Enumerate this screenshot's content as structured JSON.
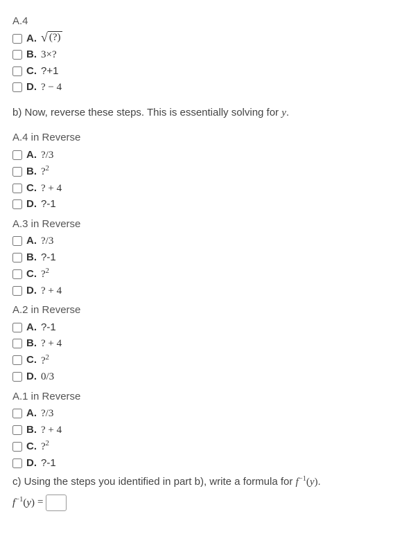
{
  "sections": {
    "a4": {
      "label": "A.4",
      "options": [
        {
          "letter": "A.",
          "text_html": "<span class='sqrt-wrap'><span class='sqrt-sym'>√</span><span class='sqrt-arg'>(?)</span></span>"
        },
        {
          "letter": "B.",
          "text_html": "<span class='math'>3×?</span>"
        },
        {
          "letter": "C.",
          "text_html": "?+1"
        },
        {
          "letter": "D.",
          "text_html": "<span class='math'>? − 4</span>"
        }
      ]
    },
    "partb_text": "b) Now, reverse these steps. This is essentially solving for ",
    "partb_var": "y",
    "a4r": {
      "label": "A.4 in Reverse",
      "options": [
        {
          "letter": "A.",
          "text_html": "<span class='math'>?/3</span>"
        },
        {
          "letter": "B.",
          "text_html": "<span class='math'>?<sup>2</sup></span>"
        },
        {
          "letter": "C.",
          "text_html": "<span class='math'>? + 4</span>"
        },
        {
          "letter": "D.",
          "text_html": "?-1"
        }
      ]
    },
    "a3r": {
      "label": "A.3 in Reverse",
      "options": [
        {
          "letter": "A.",
          "text_html": "<span class='math'>?/3</span>"
        },
        {
          "letter": "B.",
          "text_html": "?-1"
        },
        {
          "letter": "C.",
          "text_html": "<span class='math'>?<sup>2</sup></span>"
        },
        {
          "letter": "D.",
          "text_html": "<span class='math'>? + 4</span>"
        }
      ]
    },
    "a2r": {
      "label": "A.2 in Reverse",
      "options": [
        {
          "letter": "A.",
          "text_html": "?-1"
        },
        {
          "letter": "B.",
          "text_html": "<span class='math'>? + 4</span>"
        },
        {
          "letter": "C.",
          "text_html": "<span class='math'>?<sup>2</sup></span>"
        },
        {
          "letter": "D.",
          "text_html": "<span class='math'>0/3</span>"
        }
      ]
    },
    "a1r": {
      "label": "A.1 in Reverse",
      "options": [
        {
          "letter": "A.",
          "text_html": "<span class='math'>?/3</span>"
        },
        {
          "letter": "B.",
          "text_html": "<span class='math'>? + 4</span>"
        },
        {
          "letter": "C.",
          "text_html": "<span class='math'>?<sup>2</sup></span>"
        },
        {
          "letter": "D.",
          "text_html": "?-1"
        }
      ]
    },
    "partc_text": "c) Using the steps you identified in part b), write a formula for ",
    "partc_func": "f",
    "partc_arg": "y",
    "formula_lhs_f": "f",
    "formula_lhs_arg": "y",
    "eq_sign": "="
  }
}
